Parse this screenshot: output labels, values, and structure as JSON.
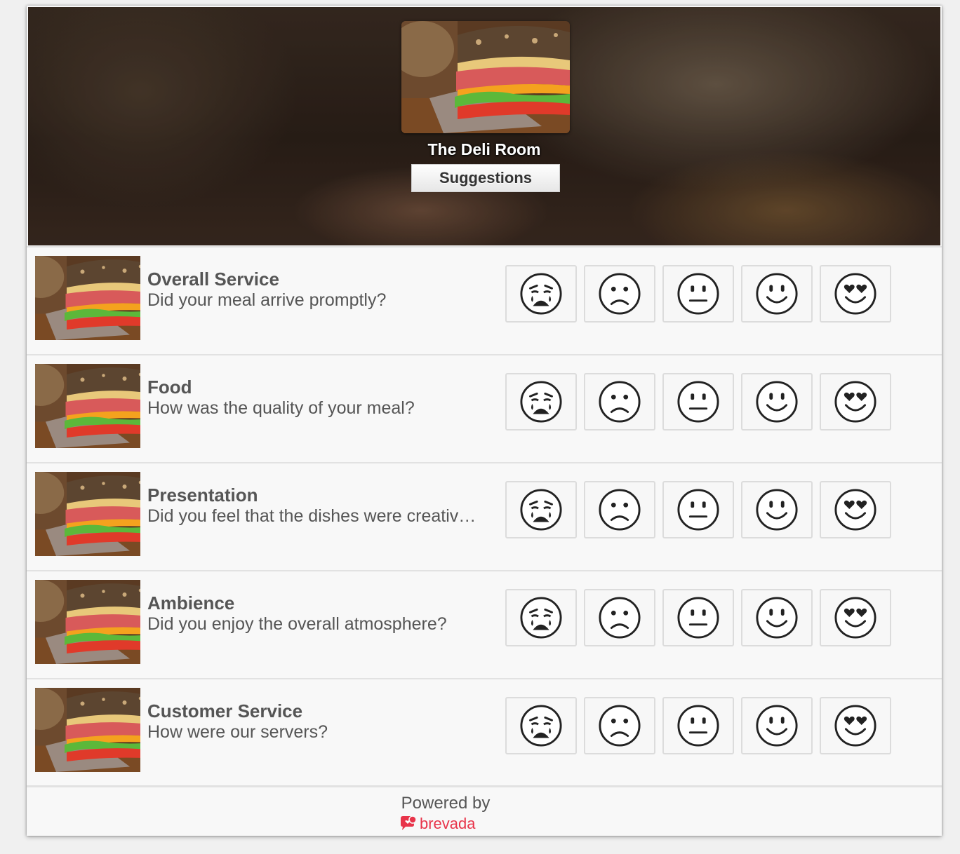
{
  "header": {
    "restaurant_name": "The Deli Room",
    "suggestions_label": "Suggestions",
    "logo_icon": "sandwich-photo"
  },
  "rating_scale": {
    "icons": [
      "crying-face-icon",
      "frowning-face-icon",
      "neutral-face-icon",
      "smiling-face-icon",
      "heart-eyes-face-icon"
    ]
  },
  "questions": [
    {
      "title": "Overall Service",
      "text": "Did your meal arrive promptly?"
    },
    {
      "title": "Food",
      "text": "How was the quality of your meal?"
    },
    {
      "title": "Presentation",
      "text": "Did you feel that the dishes were creativ…"
    },
    {
      "title": "Ambience",
      "text": "Did you enjoy the overall atmosphere?"
    },
    {
      "title": "Customer Service",
      "text": "How were our servers?"
    }
  ],
  "footer": {
    "powered_by": "Powered by",
    "brand_name": "brevada",
    "brand_color": "#e8344a"
  }
}
